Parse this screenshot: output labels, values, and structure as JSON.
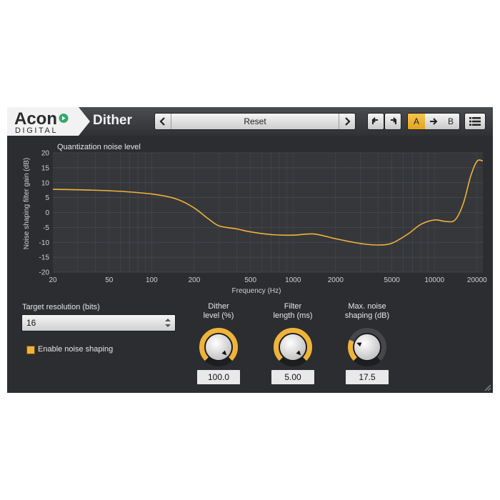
{
  "brand": {
    "name_top": "Acon",
    "name_bottom": "DIGITAL"
  },
  "plugin": {
    "name": "Dither"
  },
  "preset": {
    "name": "Reset"
  },
  "ab": {
    "a": "A",
    "b": "B",
    "active": "A"
  },
  "colors": {
    "accent": "#f0b33a",
    "curve": "#f0b33a",
    "background": "#2b2d30",
    "header": "#3a3c40"
  },
  "icons": {
    "prev": "chevron-left-icon",
    "next": "chevron-right-icon",
    "undo": "undo-icon",
    "redo": "redo-icon",
    "copy": "arrow-right-icon",
    "menu": "menu-icon"
  },
  "chart_data": {
    "type": "line",
    "title": "Quantization noise level",
    "xlabel": "Frequency (Hz)",
    "ylabel": "Noise shaping filter gain (dB)",
    "x_scale": "log",
    "xlim": [
      20,
      22000
    ],
    "ylim": [
      -20,
      20
    ],
    "x_ticks": [
      20,
      50,
      100,
      200,
      500,
      1000,
      2000,
      5000,
      10000,
      20000
    ],
    "y_ticks": [
      20,
      15,
      10,
      5,
      0,
      -5,
      -10,
      -15,
      -20
    ],
    "grid": true,
    "series": [
      {
        "x": [
          20,
          50,
          100,
          150,
          200,
          250,
          300,
          400,
          500,
          700,
          1000,
          1400,
          2000,
          3000,
          4000,
          5000,
          6500,
          8000,
          10000,
          12000,
          14000,
          16000,
          18000,
          20000,
          22000
        ],
        "y": [
          7.8,
          7.3,
          6.2,
          4.5,
          1.5,
          -2.0,
          -4.5,
          -5.5,
          -6.5,
          -7.4,
          -7.6,
          -7.2,
          -8.8,
          -10.4,
          -10.9,
          -10.3,
          -7.2,
          -4.0,
          -2.5,
          -3.0,
          -2.5,
          3.0,
          12.0,
          17.2,
          17.3
        ]
      }
    ]
  },
  "target_resolution": {
    "label": "Target resolution (bits)",
    "value": "16"
  },
  "noise_shaping": {
    "label": "Enable noise shaping",
    "checked": true
  },
  "knobs": [
    {
      "label_line1": "Dither",
      "label_line2": "level (%)",
      "value": "100.0",
      "fraction": 1.0
    },
    {
      "label_line1": "Filter",
      "label_line2": "length (ms)",
      "value": "5.00",
      "fraction": 1.0
    },
    {
      "label_line1": "Max. noise",
      "label_line2": "shaping (dB)",
      "value": "17.5",
      "fraction": 0.25
    }
  ]
}
